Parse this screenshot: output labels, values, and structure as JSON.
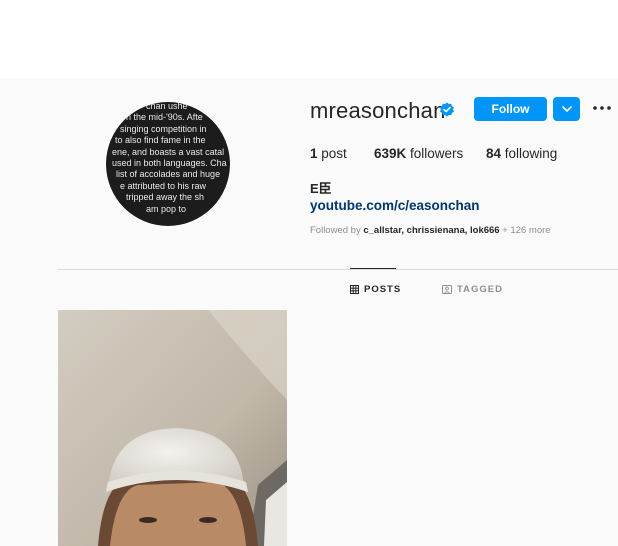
{
  "profile": {
    "username": "mreasonchan",
    "verified": true,
    "follow_label": "Follow",
    "stats": {
      "posts_count": "1",
      "posts_label": " post",
      "followers_count": "639K",
      "followers_label": " followers",
      "following_count": "84",
      "following_label": " following"
    },
    "bio_name": "E臣",
    "bio_link": "youtube.com/c/easonchan",
    "followed_by": {
      "prefix": "Followed by ",
      "names": "c_allstar, chrissienana, lok666",
      "more": " + 126 more"
    }
  },
  "avatar": {
    "text_lines": [
      "chan ushe",
      "n the mid-'90s. Afte",
      "singing competition in",
      "to also find fame in the",
      "ene, and boasts a vast catal",
      "used in both languages. Cha",
      "list of accolades and huge",
      "e attributed to his raw",
      "tripped away the sh",
      "am pop to"
    ]
  },
  "tabs": {
    "posts": "POSTS",
    "tagged": "TAGGED"
  },
  "colors": {
    "accent": "#0095f6",
    "link": "#00376b",
    "muted": "#8e8e8e",
    "text": "#262626",
    "background": "#fafafa"
  },
  "icons": {
    "verified": "verified-badge",
    "dropdown": "chevron-down",
    "more": "three-dots",
    "posts_tab": "grid",
    "tagged_tab": "tag-person"
  }
}
